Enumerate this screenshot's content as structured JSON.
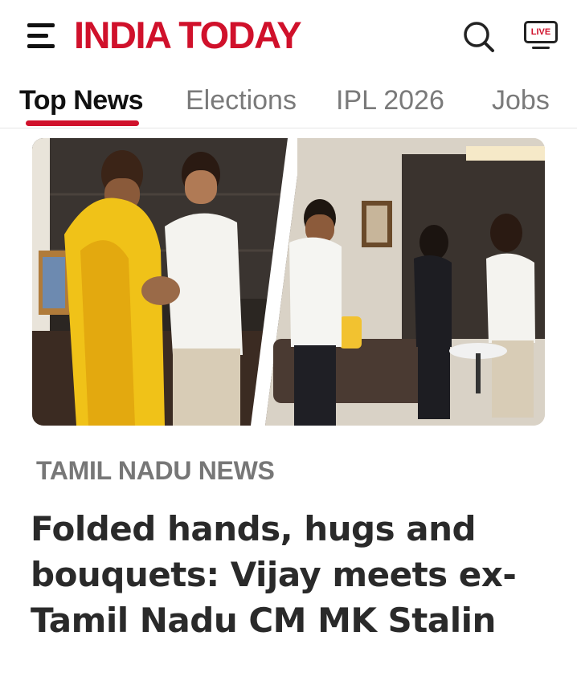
{
  "header": {
    "logo_text": "INDIA TODAY",
    "menu_icon": "hamburger-menu-icon",
    "search_icon": "search-icon",
    "live_label": "LIVE",
    "brand_color": "#d0112b"
  },
  "tabs": [
    {
      "label": "Top News",
      "active": true
    },
    {
      "label": "Elections",
      "active": false
    },
    {
      "label": "IPL 2026",
      "active": false
    },
    {
      "label": "Jobs",
      "active": false
    }
  ],
  "article": {
    "category": "TAMIL NADU NEWS",
    "headline": "Folded hands, hugs and bouquets: Vijay meets ex-Tamil Nadu CM MK Stalin"
  }
}
